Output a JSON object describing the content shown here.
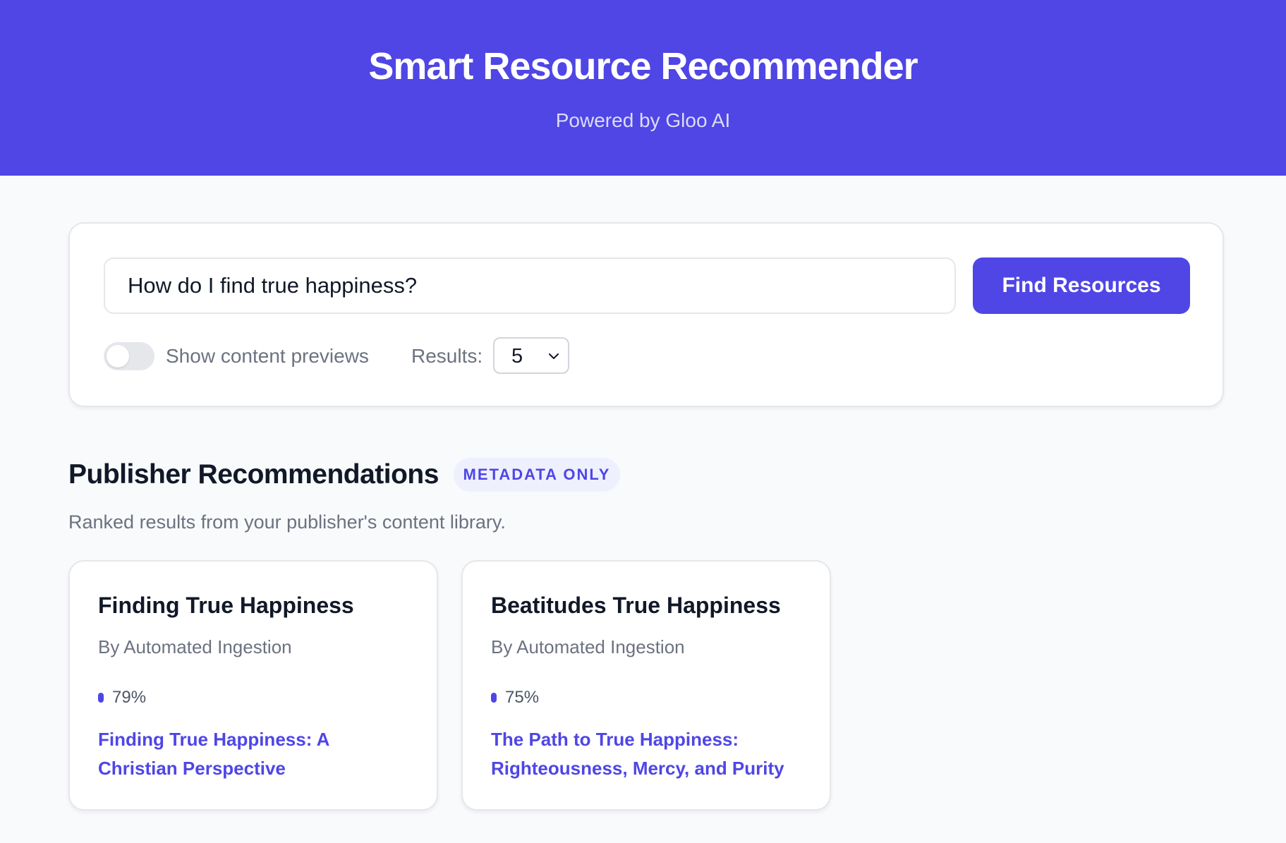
{
  "header": {
    "title": "Smart Resource Recommender",
    "subtitle": "Powered by Gloo AI"
  },
  "search": {
    "query": "How do I find true happiness?",
    "button_label": "Find Resources",
    "toggle_label": "Show content previews",
    "toggle_on": false,
    "results_label": "Results:",
    "results_value": "5"
  },
  "section": {
    "title": "Publisher Recommendations",
    "badge": "METADATA ONLY",
    "description": "Ranked results from your publisher's content library."
  },
  "cards": [
    {
      "title": "Finding True Happiness",
      "author": "By Automated Ingestion",
      "score": "79%",
      "link": "Finding True Happiness: A Christian Perspective"
    },
    {
      "title": "Beatitudes True Happiness",
      "author": "By Automated Ingestion",
      "score": "75%",
      "link": "The Path to True Happiness: Righteousness, Mercy, and Purity"
    }
  ],
  "colors": {
    "accent": "#4f46e5",
    "background": "#f8fafc",
    "badge_bg": "#eef0fd"
  }
}
